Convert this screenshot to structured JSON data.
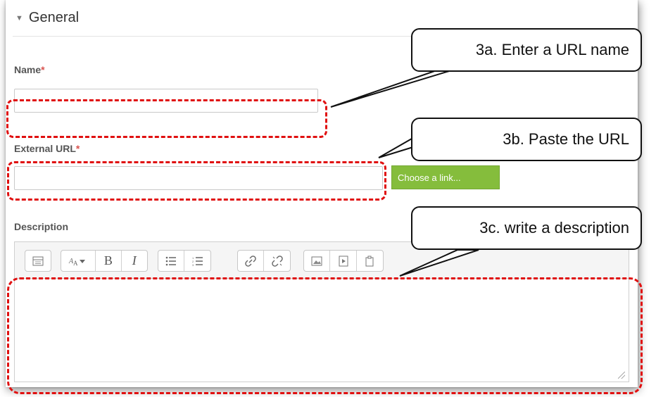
{
  "section": {
    "caret": "▼",
    "title": "General"
  },
  "form": {
    "name": {
      "label": "Name",
      "required_marker": "*",
      "value": ""
    },
    "external_url": {
      "label": "External URL",
      "required_marker": "*",
      "value": "",
      "choose_button_label": "Choose a link..."
    },
    "description": {
      "label": "Description",
      "value": "",
      "toolbar_groups": [
        [
          "show-more-buttons-icon"
        ],
        [
          "font-style-icon",
          "bold-icon",
          "italic-icon"
        ],
        [
          "unordered-list-icon",
          "ordered-list-icon"
        ],
        [
          "link-icon",
          "unlink-icon"
        ],
        [
          "image-icon",
          "media-icon",
          "paste-icon"
        ]
      ]
    }
  },
  "annotations": {
    "callout_3a": "3a. Enter a URL name",
    "callout_3b": "3b. Paste the URL",
    "callout_3c": "3c. write a description",
    "highlight_color": "#e01010"
  }
}
